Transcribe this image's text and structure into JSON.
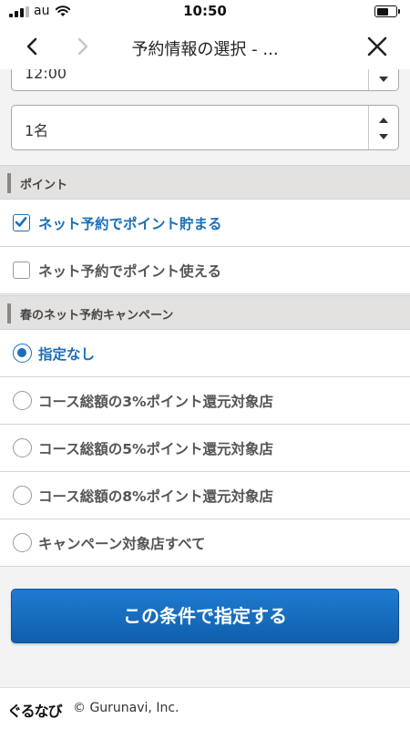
{
  "status_bar": {
    "carrier": "au",
    "time": "10:50",
    "battery_level": 0.65
  },
  "nav": {
    "title": "予約情報の選択 - ..."
  },
  "time_select": {
    "value": "12:00"
  },
  "people_select": {
    "value": "1名"
  },
  "points_section": {
    "heading": "ポイント",
    "options": [
      {
        "label": "ネット予約でポイント貯まる",
        "checked": true
      },
      {
        "label": "ネット予約でポイント使える",
        "checked": false
      }
    ]
  },
  "campaign_section": {
    "heading": "春のネット予約キャンペーン",
    "options": [
      {
        "label": "指定なし",
        "selected": true
      },
      {
        "label": "コース総額の3%ポイント還元対象店",
        "selected": false
      },
      {
        "label": "コース総額の5%ポイント還元対象店",
        "selected": false
      },
      {
        "label": "コース総額の8%ポイント還元対象店",
        "selected": false
      },
      {
        "label": "キャンペーン対象店すべて",
        "selected": false
      }
    ]
  },
  "submit_button": {
    "label": "この条件で指定する"
  },
  "footer": {
    "logo": "ぐるなび",
    "copyright": "© Gurunavi, Inc."
  },
  "colors": {
    "accent": "#1a6fb7",
    "button": "#1a6ec4",
    "section_bg": "#e4e2e0"
  },
  "icons": [
    "signal-icon",
    "wifi-icon",
    "battery-icon",
    "back-icon",
    "forward-icon",
    "close-icon",
    "chevron-down-icon",
    "chevron-up-icon",
    "checkbox-icon",
    "radio-icon"
  ]
}
